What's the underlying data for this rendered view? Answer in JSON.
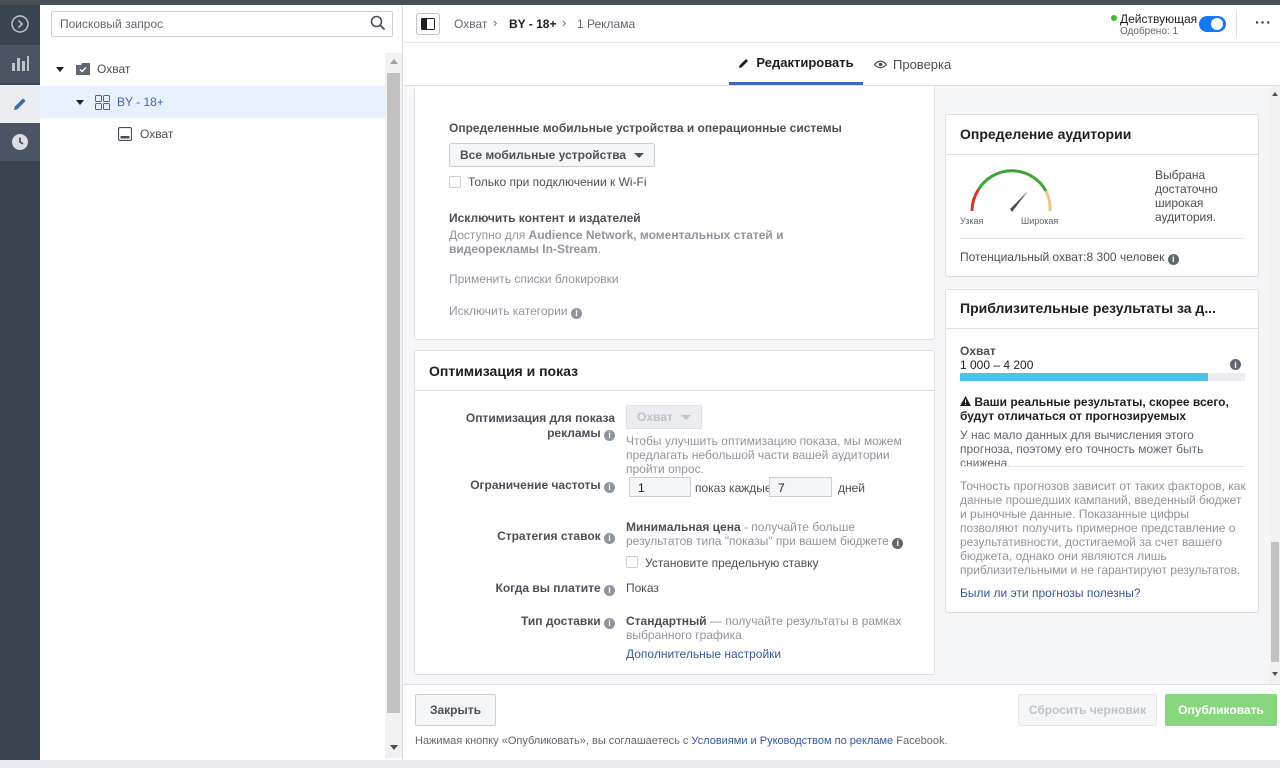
{
  "sidebar": {
    "search_placeholder": "Поисковый запрос",
    "tree": [
      {
        "label": "Охват"
      },
      {
        "label": "BY - 18+"
      },
      {
        "label": "Охват"
      }
    ]
  },
  "header": {
    "breadcrumb": [
      "Охват",
      "BY - 18+",
      "1 Реклама"
    ],
    "status": "Действующая",
    "status_sub": "Одобрено: 1"
  },
  "tabs": {
    "edit": "Редактировать",
    "review": "Проверка"
  },
  "placements": {
    "devices_label": "Определенные мобильные устройства и операционные системы",
    "devices_value": "Все мобильные устройства",
    "wifi_label": "Только при подключении к Wi-Fi",
    "exclude_title": "Исключить контент и издателей",
    "exclude_desc_1": "Доступно для ",
    "exclude_desc_bold": "Audience Network, моментальных статей и видеорекламы In-Stream",
    "exclude_desc_2": ".",
    "block_lists": "Применить списки блокировки",
    "exclude_categories": "Исключить категории"
  },
  "optimization": {
    "title": "Оптимизация и показ",
    "opt_label_1": "Оптимизация для показа",
    "opt_label_2": "рекламы",
    "opt_value": "Охват",
    "opt_help": "Чтобы улучшить оптимизацию показа, мы можем предлагать небольшой части вашей аудитории пройти опрос.",
    "freq_label": "Ограничение частоты",
    "freq_value": "1",
    "freq_mid": "показ каждые",
    "freq_days": "7",
    "freq_unit": "дней",
    "bid_label": "Стратегия ставок",
    "bid_strong": "Минимальная цена",
    "bid_desc": " - получайте больше результатов типа \"показы\" при вашем бюджете",
    "bid_cap": "Установите предельную ставку",
    "pay_label": "Когда вы платите",
    "pay_value": "Показ",
    "delivery_label": "Тип доставки",
    "delivery_strong": "Стандартный",
    "delivery_desc": " — получайте результаты в рамках выбранного графика",
    "more_settings": "Дополнительные настройки"
  },
  "audience": {
    "title": "Определение аудитории",
    "narrow": "Узкая",
    "wide": "Широкая",
    "verdict": "Выбрана достаточно широкая аудитория.",
    "reach": "Потенциальный охват:8 300 человек",
    "gauge_level": 0.78
  },
  "estimates": {
    "title": "Приблизительные результаты за д...",
    "metric": "Охват",
    "range": "1 000 – 4 200",
    "fill": 0.87,
    "warn_title": "Ваши реальные результаты, скорее всего, будут отличаться от прогнозируемых",
    "warn_desc": "У нас мало данных для вычисления этого прогноза, поэтому его точность может быть снижена.",
    "disclaimer": "Точность прогнозов зависит от таких факторов, как данные прошедших кампаний, введенный бюджет и рыночные данные. Показанные цифры позволяют получить примерное представление о результативности, достигаемой за счет вашего бюджета, однако они являются лишь приблизительными и не гарантируют результатов.",
    "feedback": "Были ли эти прогнозы полезны?"
  },
  "footer": {
    "close": "Закрыть",
    "discard": "Сбросить черновик",
    "publish": "Опубликовать",
    "terms_1": "Нажимая кнопку «Опубликовать», вы соглашаетесь с ",
    "terms_link": "Условиями и Руководством по рекламе",
    "terms_2": " Facebook."
  },
  "colors": {
    "accent": "#4267b2",
    "publish": "#88d77f",
    "status_green": "#42b72a",
    "reach_bar": "#4dc3e6"
  }
}
